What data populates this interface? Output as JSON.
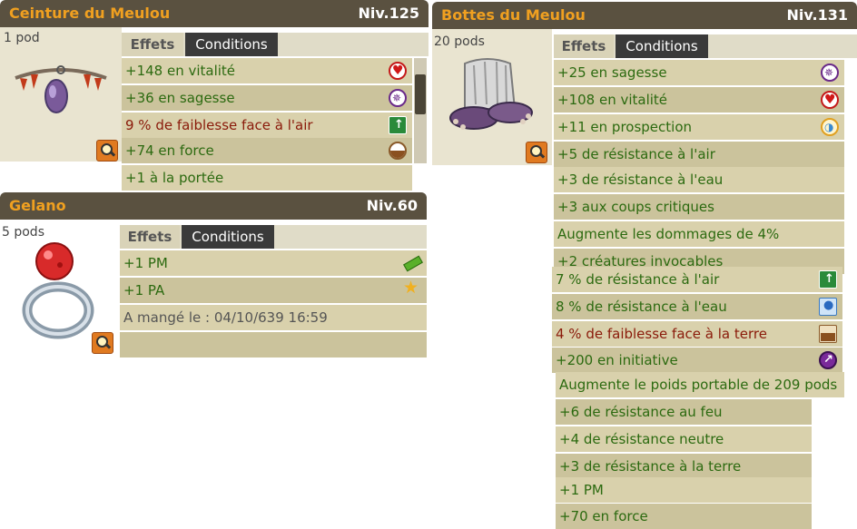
{
  "belt": {
    "name": "Ceinture du Meulou",
    "level": "Niv.125",
    "pods": "1 pod",
    "tabs": {
      "effects": "Effets",
      "conditions": "Conditions"
    },
    "effects": [
      {
        "text": "+148 en vitalité",
        "icon": "heart-icon",
        "kind": "pos"
      },
      {
        "text": "+36 en sagesse",
        "icon": "wisdom-icon",
        "kind": "pos"
      },
      {
        "text": "9 % de faiblesse face à l'air",
        "icon": "air-icon",
        "kind": "neg"
      },
      {
        "text": "+74 en force",
        "icon": "strength-icon",
        "kind": "pos"
      },
      {
        "text": "+1 à la portée",
        "icon": "",
        "kind": "pos"
      }
    ]
  },
  "ring": {
    "name": "Gelano",
    "level": "Niv.60",
    "pods": "5 pods",
    "tabs": {
      "effects": "Effets",
      "conditions": "Conditions"
    },
    "effects": [
      {
        "text": "+1 PM",
        "icon": "movement-points-icon",
        "kind": "pos"
      },
      {
        "text": "+1 PA",
        "icon": "action-points-icon",
        "kind": "pos"
      },
      {
        "text": "A mangé le : 04/10/639 16:59",
        "icon": "",
        "kind": "info"
      }
    ]
  },
  "boots": {
    "name": "Bottes du Meulou",
    "level": "Niv.131",
    "pods": "20 pods",
    "tabs": {
      "effects": "Effets",
      "conditions": "Conditions"
    },
    "effects": [
      {
        "text": "+25 en sagesse",
        "icon": "wisdom-icon",
        "kind": "pos"
      },
      {
        "text": "+108 en vitalité",
        "icon": "heart-icon",
        "kind": "pos"
      },
      {
        "text": "+11 en prospection",
        "icon": "prospecting-icon",
        "kind": "pos"
      },
      {
        "text": "+5 de résistance à l'air",
        "icon": "",
        "kind": "pos"
      },
      {
        "text": "+3 de résistance à l'eau",
        "icon": "",
        "kind": "pos"
      },
      {
        "text": "+3 aux coups critiques",
        "icon": "",
        "kind": "pos"
      },
      {
        "text": "Augmente les dommages de 4%",
        "icon": "",
        "kind": "pos"
      },
      {
        "text": "+2 créatures invocables",
        "icon": "",
        "kind": "pos"
      },
      {
        "text": "7 % de résistance à l'air",
        "icon": "air-icon",
        "kind": "pos"
      },
      {
        "text": "8 % de résistance à l'eau",
        "icon": "water-icon",
        "kind": "pos"
      },
      {
        "text": "4 % de faiblesse face à la terre",
        "icon": "earth-icon",
        "kind": "neg"
      },
      {
        "text": "+200 en initiative",
        "icon": "initiative-icon",
        "kind": "pos"
      },
      {
        "text": "Augmente le poids portable de 209 pods",
        "icon": "",
        "kind": "pos"
      },
      {
        "text": "+6 de résistance au feu",
        "icon": "",
        "kind": "pos"
      },
      {
        "text": "+4 de résistance neutre",
        "icon": "",
        "kind": "pos"
      },
      {
        "text": "+3 de résistance à la terre",
        "icon": "",
        "kind": "pos"
      },
      {
        "text": "+1 PM",
        "icon": "",
        "kind": "pos"
      },
      {
        "text": "+70 en force",
        "icon": "",
        "kind": "pos"
      }
    ]
  }
}
